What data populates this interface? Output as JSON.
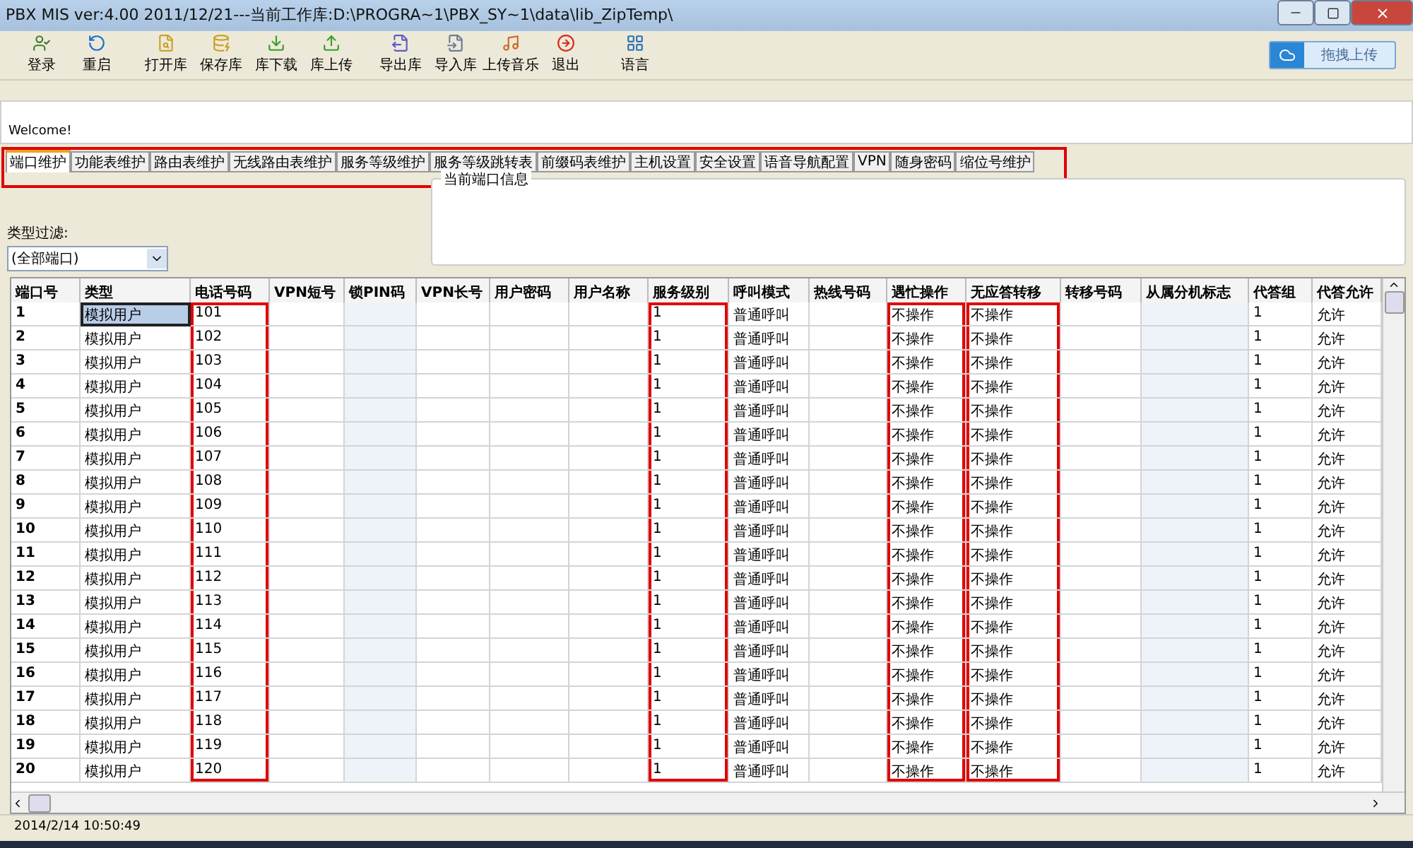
{
  "window": {
    "title": "PBX MIS ver:4.00  2011/12/21---当前工作库:D:\\PROGRA~1\\PBX_SY~1\\data\\lib_ZipTemp\\"
  },
  "toolbar": [
    {
      "kind": "login",
      "label": "登录"
    },
    {
      "kind": "restart",
      "label": "重启"
    },
    {
      "kind": "open",
      "label": "打开库"
    },
    {
      "kind": "save",
      "label": "保存库"
    },
    {
      "kind": "download",
      "label": "库下载"
    },
    {
      "kind": "upload",
      "label": "库上传"
    },
    {
      "kind": "export",
      "label": "导出库"
    },
    {
      "kind": "import",
      "label": "导入库"
    },
    {
      "kind": "music",
      "label": "上传音乐"
    },
    {
      "kind": "exit",
      "label": "退出"
    },
    {
      "kind": "language",
      "label": "语言"
    }
  ],
  "drag_upload_button": "拖拽上传",
  "message": "Welcome!",
  "tabs_highlighted": true,
  "tabs": [
    {
      "label": "端口维护",
      "selected": true
    },
    {
      "label": "功能表维护",
      "selected": false
    },
    {
      "label": "路由表维护",
      "selected": false
    },
    {
      "label": "无线路由表维护",
      "selected": false
    },
    {
      "label": "服务等级维护",
      "selected": false
    },
    {
      "label": "服务等级跳转表",
      "selected": false
    },
    {
      "label": "前缀码表维护",
      "selected": false
    },
    {
      "label": "主机设置",
      "selected": false
    },
    {
      "label": "安全设置",
      "selected": false
    },
    {
      "label": "语音导航配置",
      "selected": false
    },
    {
      "label": "VPN",
      "selected": false
    },
    {
      "label": "随身密码",
      "selected": false
    },
    {
      "label": "缩位号维护",
      "selected": false
    }
  ],
  "port_info": {
    "title": "当前端口信息"
  },
  "filter": {
    "label": "类型过滤:",
    "value": "(全部端口)"
  },
  "table": {
    "columns": [
      {
        "label": "端口号",
        "highlighted": false,
        "readonly": false
      },
      {
        "label": "类型",
        "highlighted": false,
        "readonly": false
      },
      {
        "label": "电话号码",
        "highlighted": true,
        "readonly": false
      },
      {
        "label": "VPN短号",
        "highlighted": false,
        "readonly": false
      },
      {
        "label": "锁PIN码",
        "highlighted": false,
        "readonly": true
      },
      {
        "label": "VPN长号",
        "highlighted": false,
        "readonly": false
      },
      {
        "label": "用户密码",
        "highlighted": false,
        "readonly": false
      },
      {
        "label": "用户名称",
        "highlighted": false,
        "readonly": false
      },
      {
        "label": "服务级别",
        "highlighted": true,
        "readonly": false
      },
      {
        "label": "呼叫模式",
        "highlighted": false,
        "readonly": false
      },
      {
        "label": "热线号码",
        "highlighted": false,
        "readonly": false
      },
      {
        "label": "遇忙操作",
        "highlighted": true,
        "readonly": false
      },
      {
        "label": "无应答转移",
        "highlighted": true,
        "readonly": false
      },
      {
        "label": "转移号码",
        "highlighted": false,
        "readonly": false
      },
      {
        "label": "从属分机标志",
        "highlighted": false,
        "readonly": true
      },
      {
        "label": "代答组",
        "highlighted": false,
        "readonly": false
      },
      {
        "label": "代答允许",
        "highlighted": false,
        "readonly": false
      }
    ],
    "rows": [
      {
        "selected": true,
        "port": "1",
        "type": "模拟用户",
        "phone": "101",
        "service_level": "1",
        "call_mode": "普通呼叫",
        "busy_action": "不操作",
        "no_answer": "不操作",
        "pickup_group": "1",
        "pickup_allowed": "允许"
      },
      {
        "selected": false,
        "port": "2",
        "type": "模拟用户",
        "phone": "102",
        "service_level": "1",
        "call_mode": "普通呼叫",
        "busy_action": "不操作",
        "no_answer": "不操作",
        "pickup_group": "1",
        "pickup_allowed": "允许"
      },
      {
        "selected": false,
        "port": "3",
        "type": "模拟用户",
        "phone": "103",
        "service_level": "1",
        "call_mode": "普通呼叫",
        "busy_action": "不操作",
        "no_answer": "不操作",
        "pickup_group": "1",
        "pickup_allowed": "允许"
      },
      {
        "selected": false,
        "port": "4",
        "type": "模拟用户",
        "phone": "104",
        "service_level": "1",
        "call_mode": "普通呼叫",
        "busy_action": "不操作",
        "no_answer": "不操作",
        "pickup_group": "1",
        "pickup_allowed": "允许"
      },
      {
        "selected": false,
        "port": "5",
        "type": "模拟用户",
        "phone": "105",
        "service_level": "1",
        "call_mode": "普通呼叫",
        "busy_action": "不操作",
        "no_answer": "不操作",
        "pickup_group": "1",
        "pickup_allowed": "允许"
      },
      {
        "selected": false,
        "port": "6",
        "type": "模拟用户",
        "phone": "106",
        "service_level": "1",
        "call_mode": "普通呼叫",
        "busy_action": "不操作",
        "no_answer": "不操作",
        "pickup_group": "1",
        "pickup_allowed": "允许"
      },
      {
        "selected": false,
        "port": "7",
        "type": "模拟用户",
        "phone": "107",
        "service_level": "1",
        "call_mode": "普通呼叫",
        "busy_action": "不操作",
        "no_answer": "不操作",
        "pickup_group": "1",
        "pickup_allowed": "允许"
      },
      {
        "selected": false,
        "port": "8",
        "type": "模拟用户",
        "phone": "108",
        "service_level": "1",
        "call_mode": "普通呼叫",
        "busy_action": "不操作",
        "no_answer": "不操作",
        "pickup_group": "1",
        "pickup_allowed": "允许"
      },
      {
        "selected": false,
        "port": "9",
        "type": "模拟用户",
        "phone": "109",
        "service_level": "1",
        "call_mode": "普通呼叫",
        "busy_action": "不操作",
        "no_answer": "不操作",
        "pickup_group": "1",
        "pickup_allowed": "允许"
      },
      {
        "selected": false,
        "port": "10",
        "type": "模拟用户",
        "phone": "110",
        "service_level": "1",
        "call_mode": "普通呼叫",
        "busy_action": "不操作",
        "no_answer": "不操作",
        "pickup_group": "1",
        "pickup_allowed": "允许"
      },
      {
        "selected": false,
        "port": "11",
        "type": "模拟用户",
        "phone": "111",
        "service_level": "1",
        "call_mode": "普通呼叫",
        "busy_action": "不操作",
        "no_answer": "不操作",
        "pickup_group": "1",
        "pickup_allowed": "允许"
      },
      {
        "selected": false,
        "port": "12",
        "type": "模拟用户",
        "phone": "112",
        "service_level": "1",
        "call_mode": "普通呼叫",
        "busy_action": "不操作",
        "no_answer": "不操作",
        "pickup_group": "1",
        "pickup_allowed": "允许"
      },
      {
        "selected": false,
        "port": "13",
        "type": "模拟用户",
        "phone": "113",
        "service_level": "1",
        "call_mode": "普通呼叫",
        "busy_action": "不操作",
        "no_answer": "不操作",
        "pickup_group": "1",
        "pickup_allowed": "允许"
      },
      {
        "selected": false,
        "port": "14",
        "type": "模拟用户",
        "phone": "114",
        "service_level": "1",
        "call_mode": "普通呼叫",
        "busy_action": "不操作",
        "no_answer": "不操作",
        "pickup_group": "1",
        "pickup_allowed": "允许"
      },
      {
        "selected": false,
        "port": "15",
        "type": "模拟用户",
        "phone": "115",
        "service_level": "1",
        "call_mode": "普通呼叫",
        "busy_action": "不操作",
        "no_answer": "不操作",
        "pickup_group": "1",
        "pickup_allowed": "允许"
      },
      {
        "selected": false,
        "port": "16",
        "type": "模拟用户",
        "phone": "116",
        "service_level": "1",
        "call_mode": "普通呼叫",
        "busy_action": "不操作",
        "no_answer": "不操作",
        "pickup_group": "1",
        "pickup_allowed": "允许"
      },
      {
        "selected": false,
        "port": "17",
        "type": "模拟用户",
        "phone": "117",
        "service_level": "1",
        "call_mode": "普通呼叫",
        "busy_action": "不操作",
        "no_answer": "不操作",
        "pickup_group": "1",
        "pickup_allowed": "允许"
      },
      {
        "selected": false,
        "port": "18",
        "type": "模拟用户",
        "phone": "118",
        "service_level": "1",
        "call_mode": "普通呼叫",
        "busy_action": "不操作",
        "no_answer": "不操作",
        "pickup_group": "1",
        "pickup_allowed": "允许"
      },
      {
        "selected": false,
        "port": "19",
        "type": "模拟用户",
        "phone": "119",
        "service_level": "1",
        "call_mode": "普通呼叫",
        "busy_action": "不操作",
        "no_answer": "不操作",
        "pickup_group": "1",
        "pickup_allowed": "允许"
      },
      {
        "selected": false,
        "port": "20",
        "type": "模拟用户",
        "phone": "120",
        "service_level": "1",
        "call_mode": "普通呼叫",
        "busy_action": "不操作",
        "no_answer": "不操作",
        "pickup_group": "1",
        "pickup_allowed": "允许"
      }
    ]
  },
  "status_bar": {
    "time": "2014/2/14 10:50:49"
  }
}
